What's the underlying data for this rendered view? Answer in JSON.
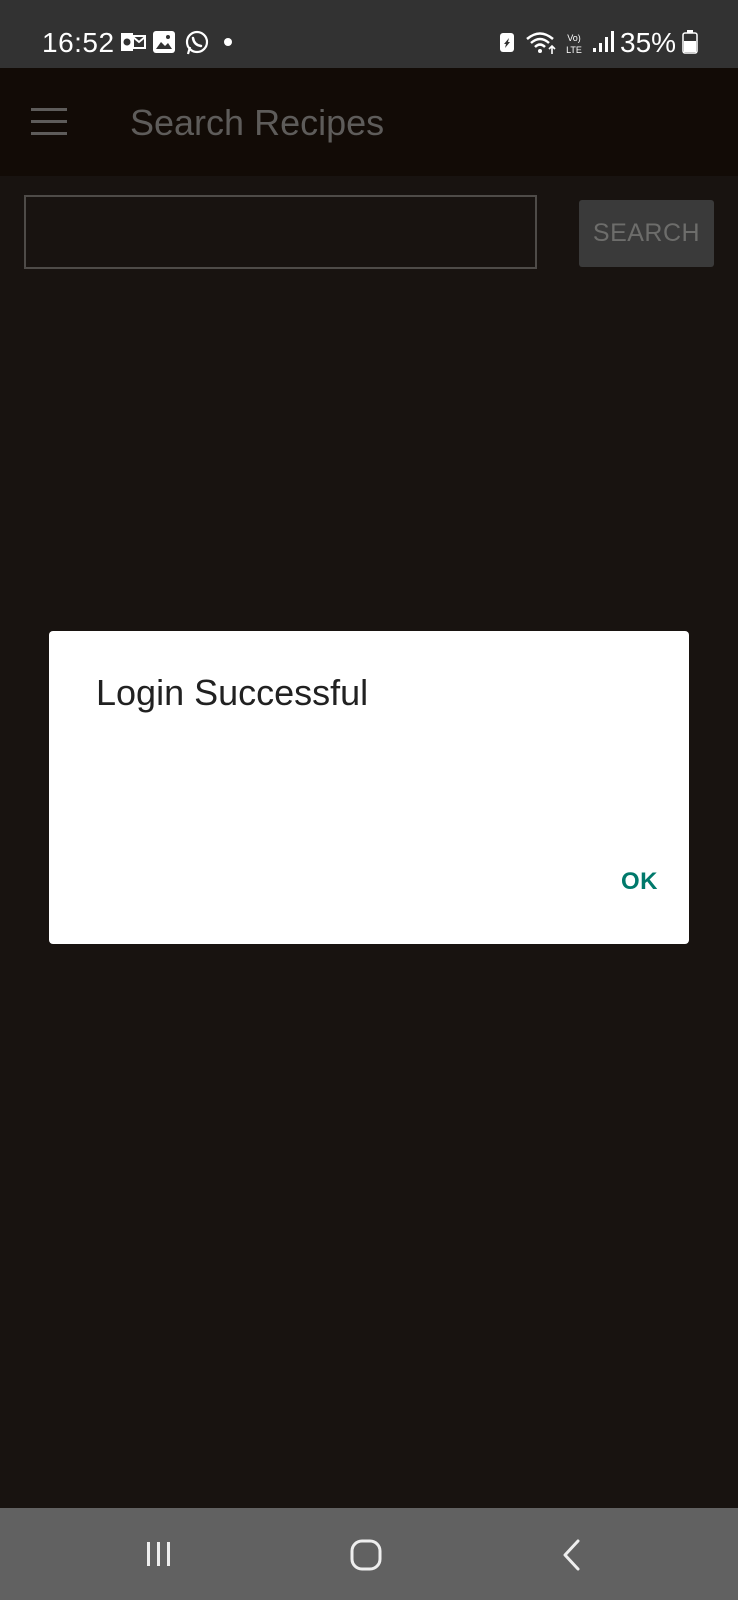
{
  "status_bar": {
    "time": "16:52",
    "battery_percent": "35%",
    "icons": [
      "outlook-icon",
      "gallery-icon",
      "whatsapp-icon",
      "battery-saver-icon",
      "wifi-icon",
      "volte-icon",
      "signal-icon",
      "battery-icon"
    ]
  },
  "app_bar": {
    "title": "Search Recipes",
    "menu_icon": "hamburger-menu-icon"
  },
  "search": {
    "value": "",
    "placeholder": "",
    "button_label": "SEARCH"
  },
  "dialog": {
    "title": "Login Successful",
    "ok_label": "OK"
  },
  "nav_bar": {
    "icons": [
      "recents-icon",
      "home-icon",
      "back-icon"
    ]
  },
  "colors": {
    "background": "#181310",
    "app_bar": "#120b06",
    "dialog_accent": "#00796b"
  }
}
